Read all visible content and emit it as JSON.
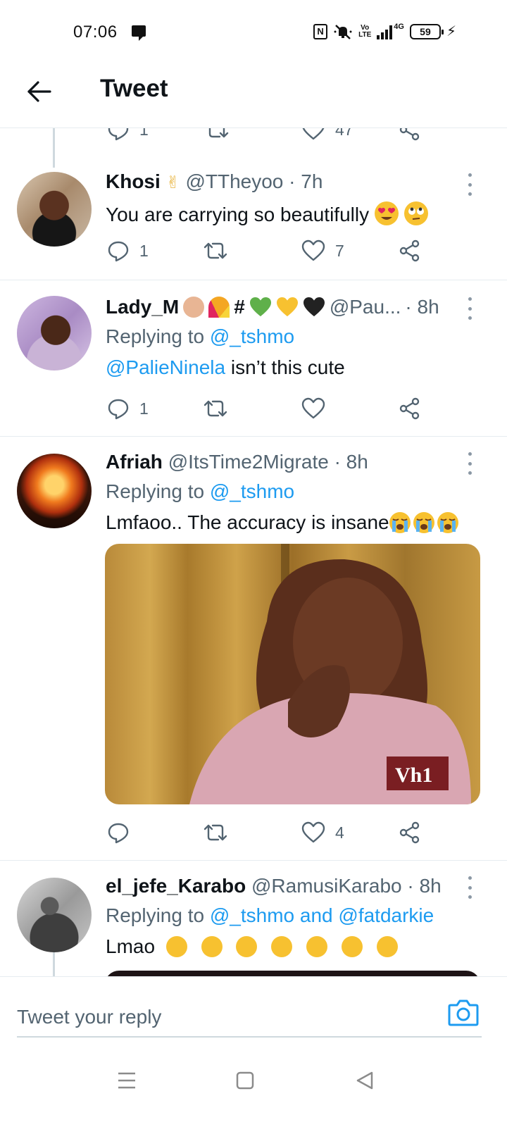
{
  "status_bar": {
    "time": "07:06",
    "nfc": "N",
    "volte": "Vo\nLTE",
    "network": "4G",
    "battery": "59"
  },
  "header": {
    "title": "Tweet"
  },
  "peek": {
    "reply_count": "1",
    "like_count": "47"
  },
  "tweets": [
    {
      "name": "Khosi",
      "handle": "@TTheyoo",
      "time": "· 7h",
      "text": "You are carrying so beautifully",
      "reply_count": "1",
      "retweet_count": "",
      "like_count": "7"
    },
    {
      "name": "Lady_M",
      "name_suffix": "#",
      "handle": "@Pau...",
      "time": "· 8h",
      "replying_prefix": "Replying to",
      "replying_to": "@_tshmo",
      "mention": "@PalieNinela",
      "text": " isn’t this cute",
      "reply_count": "1",
      "retweet_count": "",
      "like_count": ""
    },
    {
      "name": "Afriah",
      "handle": "@ItsTime2Migrate",
      "time": "· 8h",
      "replying_prefix": "Replying to",
      "replying_to": "@_tshmo",
      "text": "Lmfaoo.. The accuracy is insane",
      "media_logo": "Vh1",
      "reply_count": "",
      "retweet_count": "",
      "like_count": "4"
    },
    {
      "name": "el_jefe_Karabo",
      "handle": "@RamusiKarabo",
      "time": "· 8h",
      "replying_prefix": "Replying to",
      "replying_to": "@_tshmo and @fatdarkie",
      "text": "Lmao"
    }
  ],
  "reply_bar": {
    "placeholder": "Tweet your reply"
  },
  "colors": {
    "link": "#1d9bf0",
    "secondary_text": "#536471",
    "primary_text": "#0f1419",
    "divider": "#e6ecf0"
  },
  "icons": {
    "back": "arrow-left-icon",
    "more": "more-vertical-icon",
    "reply": "reply-bubble-icon",
    "retweet": "retweet-icon",
    "like": "heart-icon",
    "share": "share-icon",
    "camera": "camera-icon",
    "nav_menu": "menu-lines-icon",
    "nav_home": "square-icon",
    "nav_back": "triangle-back-icon"
  }
}
